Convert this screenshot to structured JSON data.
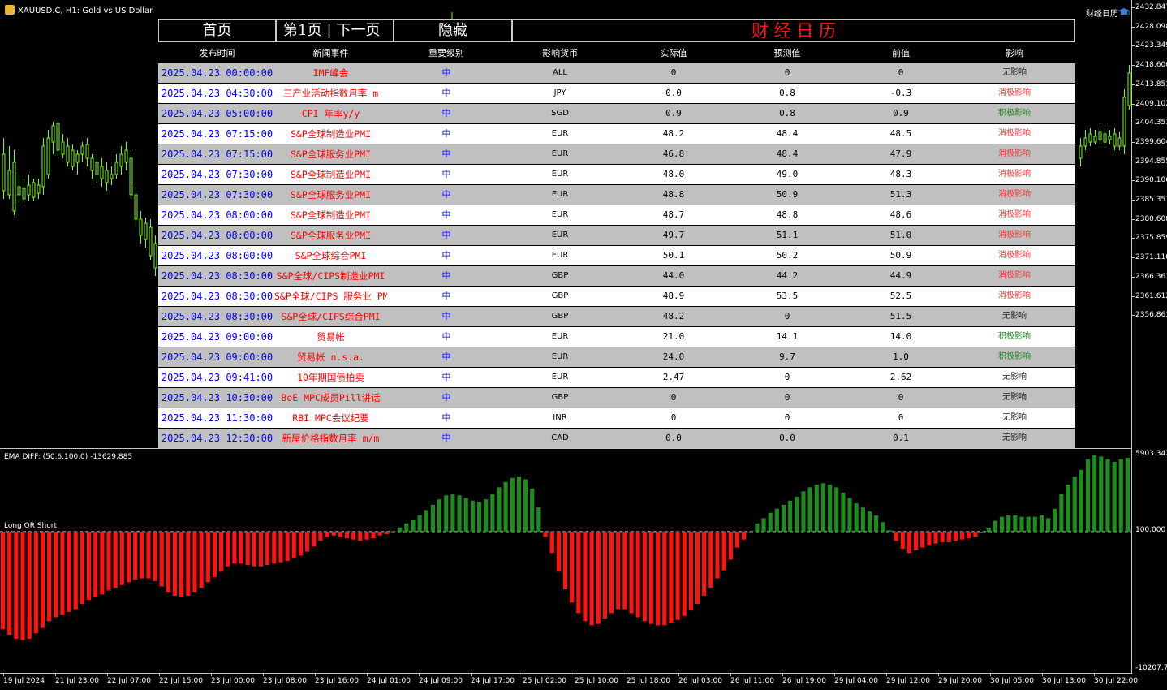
{
  "window": {
    "title": "XAUUSD.C, H1:  Gold vs US Dollar",
    "calendar_button": "财经日历"
  },
  "nav": {
    "home": "首页",
    "page": "第1页",
    "next": "下一页",
    "hide": "隐藏",
    "title": "财 经 日 历"
  },
  "table": {
    "headers": [
      "发布时间",
      "新闻事件",
      "重要级别",
      "影响货币",
      "实际值",
      "预测值",
      "前值",
      "影响"
    ],
    "rows": [
      {
        "time": "2025.04.23 00:00:00",
        "event": "IMF峰会",
        "level": "中",
        "currency": "ALL",
        "actual": "0",
        "forecast": "0",
        "previous": "0",
        "impact": "无影响",
        "impact_type": "none"
      },
      {
        "time": "2025.04.23 04:30:00",
        "event": "三产业活动指数月率 m",
        "level": "中",
        "currency": "JPY",
        "actual": "0.0",
        "forecast": "0.8",
        "previous": "-0.3",
        "impact": "消极影响",
        "impact_type": "neg"
      },
      {
        "time": "2025.04.23 05:00:00",
        "event": "CPI 年率y/y",
        "level": "中",
        "currency": "SGD",
        "actual": "0.9",
        "forecast": "0.8",
        "previous": "0.9",
        "impact": "积极影响",
        "impact_type": "pos"
      },
      {
        "time": "2025.04.23 07:15:00",
        "event": "S&P全球制造业PMI",
        "level": "中",
        "currency": "EUR",
        "actual": "48.2",
        "forecast": "48.4",
        "previous": "48.5",
        "impact": "消极影响",
        "impact_type": "neg"
      },
      {
        "time": "2025.04.23 07:15:00",
        "event": "S&P全球服务业PMI",
        "level": "中",
        "currency": "EUR",
        "actual": "46.8",
        "forecast": "48.4",
        "previous": "47.9",
        "impact": "消极影响",
        "impact_type": "neg"
      },
      {
        "time": "2025.04.23 07:30:00",
        "event": "S&P全球制造业PMI",
        "level": "中",
        "currency": "EUR",
        "actual": "48.0",
        "forecast": "49.0",
        "previous": "48.3",
        "impact": "消极影响",
        "impact_type": "neg"
      },
      {
        "time": "2025.04.23 07:30:00",
        "event": "S&P全球服务业PMI",
        "level": "中",
        "currency": "EUR",
        "actual": "48.8",
        "forecast": "50.9",
        "previous": "51.3",
        "impact": "消极影响",
        "impact_type": "neg"
      },
      {
        "time": "2025.04.23 08:00:00",
        "event": "S&P全球制造业PMI",
        "level": "中",
        "currency": "EUR",
        "actual": "48.7",
        "forecast": "48.8",
        "previous": "48.6",
        "impact": "消极影响",
        "impact_type": "neg"
      },
      {
        "time": "2025.04.23 08:00:00",
        "event": "S&P全球服务业PMI",
        "level": "中",
        "currency": "EUR",
        "actual": "49.7",
        "forecast": "51.1",
        "previous": "51.0",
        "impact": "消极影响",
        "impact_type": "neg"
      },
      {
        "time": "2025.04.23 08:00:00",
        "event": "S&P全球综合PMI",
        "level": "中",
        "currency": "EUR",
        "actual": "50.1",
        "forecast": "50.2",
        "previous": "50.9",
        "impact": "消极影响",
        "impact_type": "neg"
      },
      {
        "time": "2025.04.23 08:30:00",
        "event": "S&P全球/CIPS制造业PMI",
        "level": "中",
        "currency": "GBP",
        "actual": "44.0",
        "forecast": "44.2",
        "previous": "44.9",
        "impact": "消极影响",
        "impact_type": "neg"
      },
      {
        "time": "2025.04.23 08:30:00",
        "event": "S&P全球/CIPS 服务业 PMI",
        "level": "中",
        "currency": "GBP",
        "actual": "48.9",
        "forecast": "53.5",
        "previous": "52.5",
        "impact": "消极影响",
        "impact_type": "neg"
      },
      {
        "time": "2025.04.23 08:30:00",
        "event": "S&P全球/CIPS综合PMI",
        "level": "中",
        "currency": "GBP",
        "actual": "48.2",
        "forecast": "0",
        "previous": "51.5",
        "impact": "无影响",
        "impact_type": "none"
      },
      {
        "time": "2025.04.23 09:00:00",
        "event": "贸易帐",
        "level": "中",
        "currency": "EUR",
        "actual": "21.0",
        "forecast": "14.1",
        "previous": "14.0",
        "impact": "积极影响",
        "impact_type": "pos"
      },
      {
        "time": "2025.04.23 09:00:00",
        "event": "贸易帐 n.s.a.",
        "level": "中",
        "currency": "EUR",
        "actual": "24.0",
        "forecast": "9.7",
        "previous": "1.0",
        "impact": "积极影响",
        "impact_type": "pos"
      },
      {
        "time": "2025.04.23 09:41:00",
        "event": "10年期国债拍卖",
        "level": "中",
        "currency": "EUR",
        "actual": "2.47",
        "forecast": "0",
        "previous": "2.62",
        "impact": "无影响",
        "impact_type": "none"
      },
      {
        "time": "2025.04.23 10:30:00",
        "event": "BoE MPC成员Pill讲话",
        "level": "中",
        "currency": "GBP",
        "actual": "0",
        "forecast": "0",
        "previous": "0",
        "impact": "无影响",
        "impact_type": "none"
      },
      {
        "time": "2025.04.23 11:30:00",
        "event": "RBI MPC会议纪要",
        "level": "中",
        "currency": "INR",
        "actual": "0",
        "forecast": "0",
        "previous": "0",
        "impact": "无影响",
        "impact_type": "none"
      },
      {
        "time": "2025.04.23 12:30:00",
        "event": "新屋价格指数月率 m/m",
        "level": "中",
        "currency": "CAD",
        "actual": "0.0",
        "forecast": "0.0",
        "previous": "0.1",
        "impact": "无影响",
        "impact_type": "none"
      }
    ]
  },
  "price_axis": [
    "2432.847",
    "2428.098",
    "2423.349",
    "2418.600",
    "2413.851",
    "2409.102",
    "2404.353",
    "2399.604",
    "2394.855",
    "2390.106",
    "2385.357",
    "2380.608",
    "2375.859",
    "2371.110",
    "2366.361",
    "2361.612",
    "2356.863"
  ],
  "indicator": {
    "label": "EMA DIFF: (50,6,100.0) -13629.885",
    "level_label": "Long OR Short",
    "axis": [
      "5903.342",
      "100.000",
      "-10207.70"
    ],
    "up_color": "#1e8c1e",
    "down_color": "#ff1414"
  },
  "time_axis": [
    "19 Jul 2024",
    "21 Jul 23:00",
    "22 Jul 07:00",
    "22 Jul 15:00",
    "23 Jul 00:00",
    "23 Jul 08:00",
    "23 Jul 16:00",
    "24 Jul 01:00",
    "24 Jul 09:00",
    "24 Jul 17:00",
    "25 Jul 02:00",
    "25 Jul 10:00",
    "25 Jul 18:00",
    "26 Jul 03:00",
    "26 Jul 11:00",
    "26 Jul 19:00",
    "29 Jul 04:00",
    "29 Jul 12:00",
    "29 Jul 20:00",
    "30 Jul 05:00",
    "30 Jul 13:00",
    "30 Jul 22:00"
  ],
  "colors": {
    "candle": "#7CFC00",
    "title_red": "#ff1a1a",
    "pos": "#1e8c1e",
    "neg": "#ff3333",
    "none": "#222222"
  },
  "chart_data": {
    "type": "bar",
    "title": "EMA DIFF: (50,6,100.0) -13629.885",
    "ylim": [
      -10207.7,
      5903.342
    ],
    "values": [
      -7200,
      -7600,
      -7900,
      -8000,
      -7900,
      -7500,
      -7100,
      -6600,
      -6300,
      -6100,
      -5900,
      -5700,
      -5300,
      -5000,
      -4800,
      -4600,
      -4300,
      -4100,
      -3900,
      -3700,
      -3500,
      -3400,
      -3400,
      -3600,
      -4000,
      -4400,
      -4700,
      -4800,
      -4700,
      -4400,
      -4100,
      -3700,
      -3300,
      -2900,
      -2500,
      -2300,
      -2300,
      -2400,
      -2500,
      -2500,
      -2400,
      -2300,
      -2200,
      -2100,
      -1900,
      -1700,
      -1400,
      -1000,
      -600,
      -300,
      -200,
      -300,
      -400,
      -500,
      -600,
      -500,
      -400,
      -200,
      -100,
      100,
      400,
      700,
      1000,
      1300,
      1700,
      2100,
      2500,
      2800,
      2900,
      2800,
      2600,
      2400,
      2300,
      2500,
      2900,
      3400,
      3800,
      4100,
      4200,
      4000,
      3300,
      1900,
      -300,
      -1500,
      -2900,
      -4200,
      -5200,
      -6000,
      -6600,
      -6900,
      -6800,
      -6400,
      -6000,
      -5700,
      -5700,
      -6000,
      -6300,
      -6600,
      -6800,
      -6900,
      -6900,
      -6700,
      -6500,
      -6200,
      -5800,
      -5300,
      -4700,
      -4100,
      -3400,
      -2800,
      -2000,
      -1100,
      -500,
      100,
      700,
      1100,
      1500,
      1800,
      2100,
      2400,
      2700,
      3100,
      3400,
      3600,
      3700,
      3600,
      3400,
      3000,
      2600,
      2200,
      1900,
      1600,
      1300,
      800,
      200,
      -600,
      -1200,
      -1500,
      -1300,
      -1100,
      -900,
      -800,
      -700,
      -700,
      -600,
      -500,
      -400,
      -300,
      100,
      400,
      900,
      1200,
      1300,
      1300,
      1200,
      1200,
      1200,
      1300,
      1100,
      1800,
      2900,
      3600,
      4200,
      4700,
      5500,
      5800,
      5700,
      5500,
      5300,
      5500,
      5600
    ]
  }
}
